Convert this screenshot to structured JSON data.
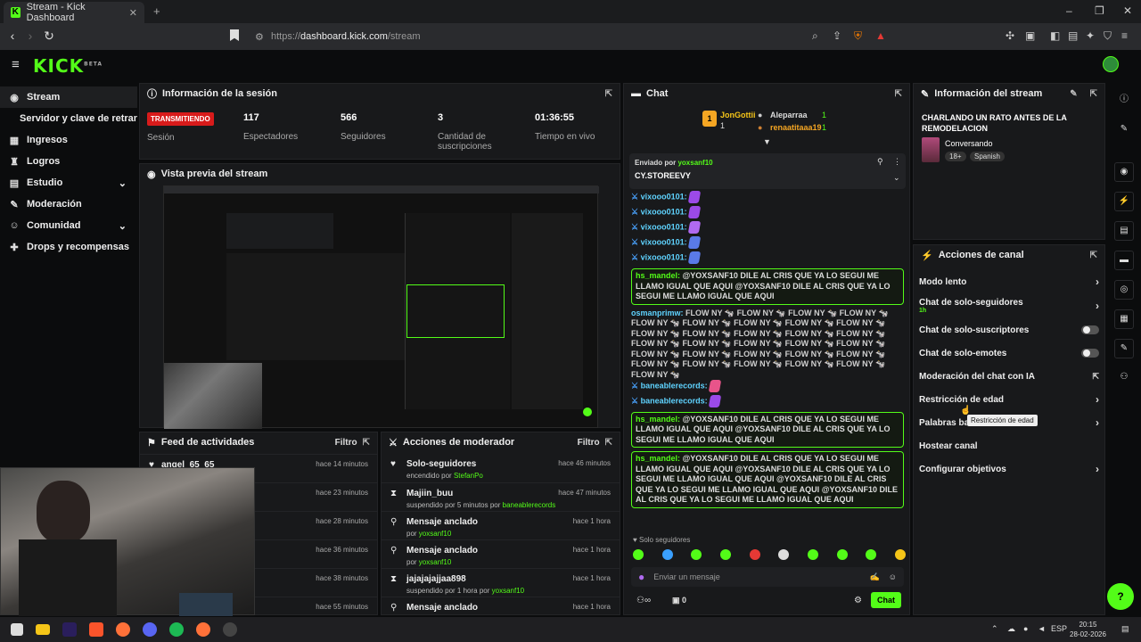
{
  "browser": {
    "tab_title": "Stream - Kick Dashboard",
    "url_prefix": "https://",
    "url_domain": "dashboard.kick.com",
    "url_path": "/stream",
    "tab_close": "✕",
    "tab_add": "+"
  },
  "header": {
    "logo": "KICK",
    "beta": "BETA"
  },
  "sidebar": {
    "items": [
      {
        "label": "Stream",
        "icon": "broadcast-icon"
      },
      {
        "label": "Servidor y clave de retransmisión",
        "icon": ""
      },
      {
        "label": "Ingresos",
        "icon": "grid-icon"
      },
      {
        "label": "Logros",
        "icon": "trophy-icon"
      },
      {
        "label": "Estudio",
        "icon": "clapper-icon"
      },
      {
        "label": "Moderación",
        "icon": "wrench-icon"
      },
      {
        "label": "Comunidad",
        "icon": "people-icon"
      },
      {
        "label": "Drops y recompensas",
        "icon": "gift-icon"
      }
    ]
  },
  "session": {
    "title": "Información de la sesión",
    "status": "TRANSMITIENDO",
    "status_label": "Sesión",
    "stats": [
      {
        "value": "117",
        "label": "Espectadores"
      },
      {
        "value": "566",
        "label": "Seguidores"
      },
      {
        "value": "3",
        "label": "Cantidad de suscripciones"
      },
      {
        "value": "01:36:55",
        "label": "Tiempo en vivo"
      }
    ]
  },
  "preview": {
    "title": "Vista previa del stream"
  },
  "feed": {
    "title": "Feed de actividades",
    "filter": "Filtro",
    "items": [
      {
        "name": "angel_65_65",
        "time": "hace 14 minutos"
      },
      {
        "name": "",
        "time": "hace 23 minutos"
      },
      {
        "name": "",
        "time": "hace 28 minutos"
      },
      {
        "name": "",
        "time": "hace 36 minutos"
      },
      {
        "name": "",
        "time": "hace 38 minutos"
      },
      {
        "name": "",
        "time": "hace 55 minutos"
      }
    ]
  },
  "modactions": {
    "title": "Acciones de moderador",
    "filter": "Filtro",
    "items": [
      {
        "name": "Solo-seguidores",
        "sub": "encendido por",
        "by": "StefanPo",
        "time": "hace 46 minutos"
      },
      {
        "name": "Majiin_buu",
        "sub": "suspendido por 5 minutos por",
        "by": "baneablerecords",
        "time": "hace 47 minutos"
      },
      {
        "name": "Mensaje anclado",
        "sub": "por",
        "by": "yoxsanf10",
        "time": "hace 1 hora"
      },
      {
        "name": "Mensaje anclado",
        "sub": "por",
        "by": "yoxsanf10",
        "time": "hace 1 hora"
      },
      {
        "name": "jajajajajjaa898",
        "sub": "suspendido por 1 hora por",
        "by": "yoxsanf10",
        "time": "hace 1 hora"
      },
      {
        "name": "Mensaje anclado",
        "sub": "",
        "by": "",
        "time": "hace 1 hora"
      }
    ]
  },
  "chat": {
    "title": "Chat",
    "leaderboard": [
      {
        "name": "JonGottii",
        "count": "1"
      },
      {
        "name": "Aleparraa",
        "count": "1"
      },
      {
        "name": "renaatitaaa19",
        "count": "1"
      }
    ],
    "pinned": {
      "label": "Enviado por",
      "user": "yoxsanf10",
      "text": "CY.STOREEVY"
    },
    "followers_only": "Solo seguidores",
    "input_placeholder": "Enviar un mensaje",
    "points": "0",
    "send": "Chat",
    "flow_user": "osmanprimw:",
    "flow_text": "FLOW NY 🐄 FLOW NY 🐄 FLOW NY 🐄 FLOW NY 🐄 FLOW NY 🐄 FLOW NY 🐄 FLOW NY 🐄 FLOW NY 🐄 FLOW NY 🐄 FLOW NY 🐄 FLOW NY 🐄 FLOW NY 🐄 FLOW NY 🐄 FLOW NY 🐄 FLOW NY 🐄 FLOW NY 🐄 FLOW NY 🐄 FLOW NY 🐄 FLOW NY 🐄 FLOW NY 🐄 FLOW NY 🐄 FLOW NY 🐄 FLOW NY 🐄 FLOW NY 🐄 FLOW NY 🐄 FLOW NY 🐄 FLOW NY 🐄 FLOW NY 🐄 FLOW NY 🐄 FLOW NY 🐄",
    "vix": "vixooo0101:",
    "bane": "baneablerecords:",
    "mandel": "hs_mandel:",
    "mandel_text": "@YOXSANF10 DILE AL CRIS QUE YA LO SEGUI ME LLAMO IGUAL QUE AQUI @YOXSANF10 DILE AL CRIS QUE YA LO SEGUI ME LLAMO IGUAL QUE AQUI"
  },
  "streaminfo": {
    "title": "Información del stream",
    "stream_title": "CHARLANDO UN RATO ANTES DE LA REMODELACION",
    "category": "Conversando",
    "tags": [
      "18+",
      "Spanish"
    ]
  },
  "channel": {
    "title": "Acciones de canal",
    "items": [
      {
        "label": "Modo lento",
        "extra": "",
        "ctrl": "chev"
      },
      {
        "label": "Chat de solo-seguidores",
        "extra": "1h",
        "ctrl": "chev"
      },
      {
        "label": "Chat de solo-suscriptores",
        "extra": "",
        "ctrl": "toggle"
      },
      {
        "label": "Chat de solo-emotes",
        "extra": "",
        "ctrl": "toggle"
      },
      {
        "label": "Moderación del chat con IA",
        "extra": "",
        "ctrl": "ext"
      },
      {
        "label": "Restricción de edad",
        "extra": "",
        "ctrl": "chev"
      },
      {
        "label": "Palabras bar",
        "extra": "",
        "ctrl": "chev"
      },
      {
        "label": "Hostear canal",
        "extra": "",
        "ctrl": "none"
      },
      {
        "label": "Configurar objetivos",
        "extra": "",
        "ctrl": "chev"
      }
    ],
    "tooltip": "Restricción de edad"
  },
  "taskbar": {
    "lang": "ESP",
    "time": "20:15",
    "date": "28-02-2026"
  },
  "colors": {
    "accent": "#53fc18",
    "live": "#d81b1b",
    "bg": "#0b0c0d",
    "panel": "#18191b"
  }
}
